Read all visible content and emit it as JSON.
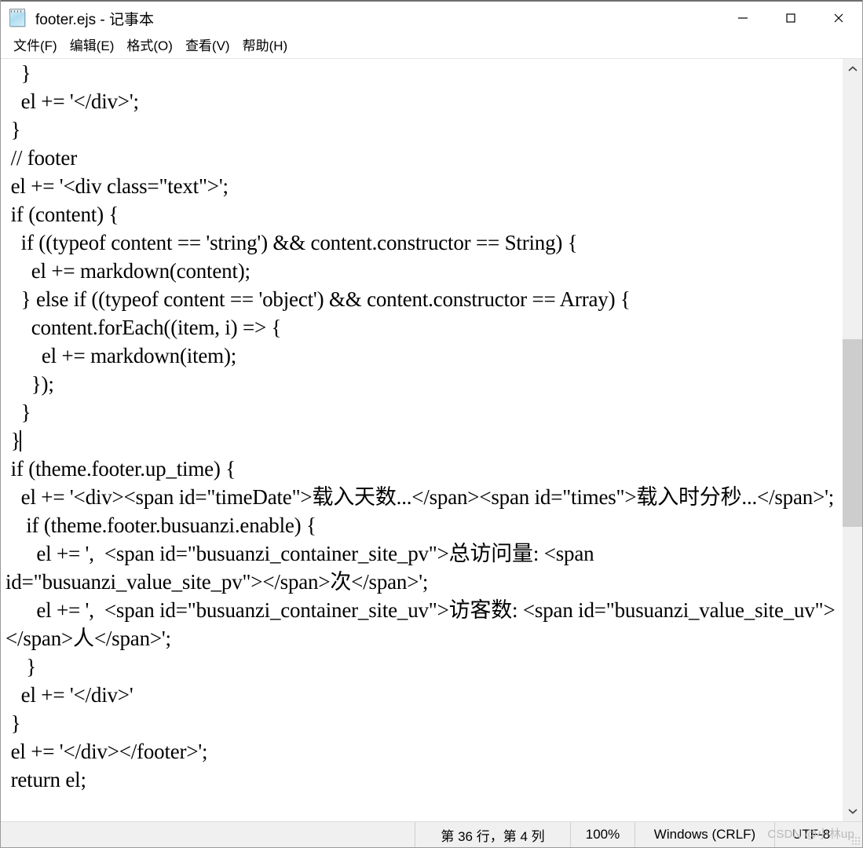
{
  "window": {
    "title": "footer.ejs - 记事本",
    "icon": "notepad-icon",
    "controls": {
      "minimize": "最小化",
      "maximize": "最大化",
      "close": "关闭"
    }
  },
  "menubar": {
    "items": [
      {
        "label": "文件(F)",
        "name": "menu-file"
      },
      {
        "label": "编辑(E)",
        "name": "menu-edit"
      },
      {
        "label": "格式(O)",
        "name": "menu-format"
      },
      {
        "label": "查看(V)",
        "name": "menu-view"
      },
      {
        "label": "帮助(H)",
        "name": "menu-help"
      }
    ]
  },
  "editor": {
    "font": "serif",
    "word_wrap": true,
    "text_before_caret": "   }\n   el += '</div>';\n }\n // footer\n el += '<div class=\"text\">';\n if (content) {\n   if ((typeof content == 'string') && content.constructor == String) {\n     el += markdown(content);\n   } else if ((typeof content == 'object') && content.constructor == Array) {\n     content.forEach((item, i) => {\n       el += markdown(item);\n     });\n   }\n }",
    "text_after_caret": "\n if (theme.footer.up_time) {\n   el += '<div><span id=\"timeDate\">载入天数...</span><span id=\"times\">载入时分秒...</span>';\n    if (theme.footer.busuanzi.enable) {\n      el += ',  <span id=\"busuanzi_container_site_pv\">总访问量: <span id=\"busuanzi_value_site_pv\"></span>次</span>';\n      el += ',  <span id=\"busuanzi_container_site_uv\">访客数: <span id=\"busuanzi_value_site_uv\"></span>人</span>';\n    }\n   el += '</div>'\n }\n el += '</div></footer>';\n return el;",
    "caret_line": 36,
    "caret_column": 4
  },
  "scrollbar": {
    "up_arrow": "▲",
    "down_arrow": "▼",
    "thumb_top_pct": 36,
    "thumb_height_pct": 26
  },
  "statusbar": {
    "position": "第 36 行，第 4 列",
    "zoom": "100%",
    "line_ending": "Windows (CRLF)",
    "encoding": "UTF-8",
    "watermark": "CSDN @小林up"
  },
  "colors": {
    "window_bg": "#ffffff",
    "statusbar_bg": "#f0f0f0",
    "scrollbar_track": "#f0f0f0",
    "scrollbar_thumb": "#cdcdcd",
    "text": "#000000",
    "watermark": "#b9b9b9",
    "close_hover": "#e81123"
  }
}
